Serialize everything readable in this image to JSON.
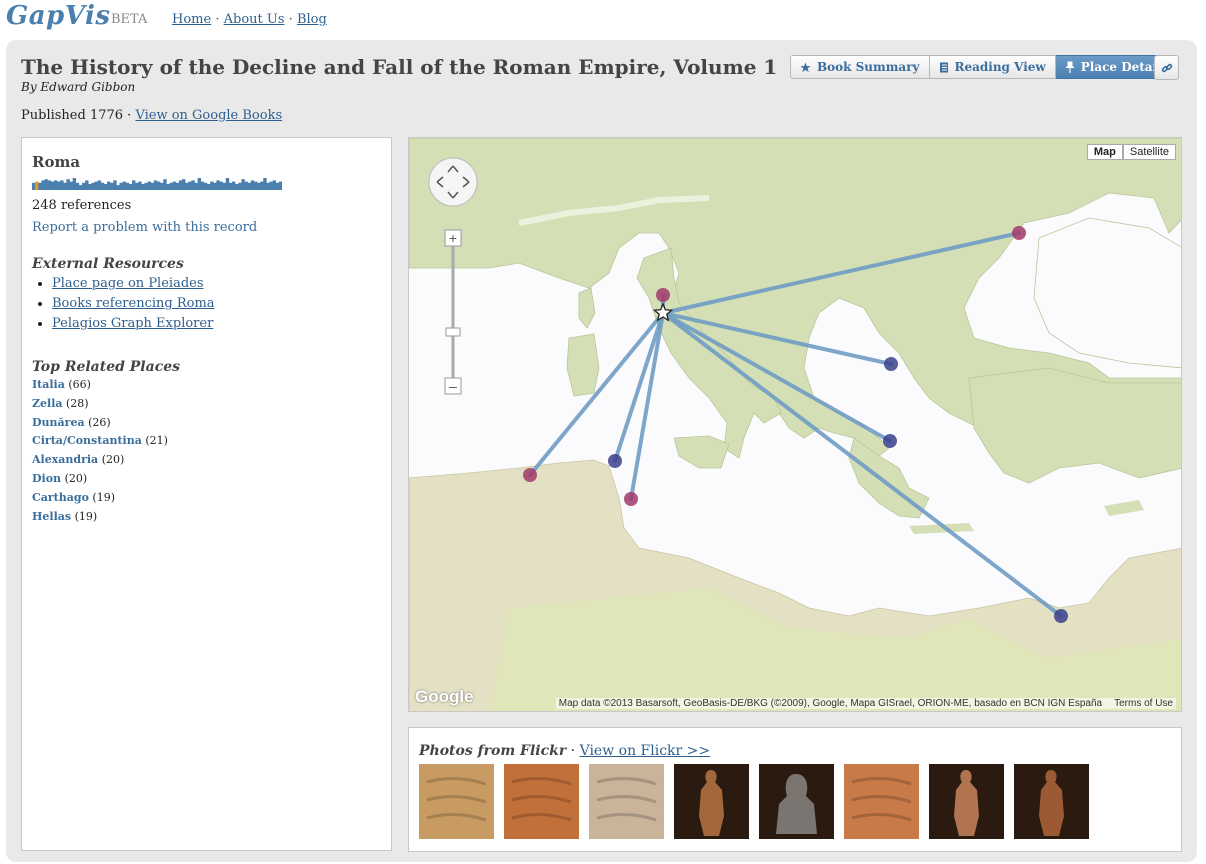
{
  "header": {
    "logo": "GapVis",
    "beta": "BETA",
    "nav": [
      {
        "label": "Home"
      },
      {
        "label": "About Us"
      },
      {
        "label": "Blog"
      }
    ],
    "sep": "·"
  },
  "book": {
    "title": "The History of the Decline and Fall of the Roman Empire, Volume 1",
    "author": "By Edward Gibbon",
    "published": "Published 1776 ·",
    "google_link": "View on Google Books"
  },
  "views": {
    "summary": "Book Summary",
    "reading": "Reading View",
    "place": "Place Detail",
    "active": "place"
  },
  "place": {
    "name": "Roma",
    "references": "248 references",
    "report": "Report a problem with this record",
    "reference_bars": [
      0.6,
      0.7,
      0.6,
      0.8,
      0.9,
      0.8,
      0.7,
      0.8,
      0.7,
      0.8,
      0.6,
      0.9,
      0.7,
      1.0,
      0.6,
      0.4,
      0.6,
      0.8,
      0.5,
      0.6,
      0.7,
      0.8,
      0.6,
      0.5,
      0.7,
      0.6,
      0.8,
      0.4,
      0.6,
      0.7,
      0.6,
      0.5,
      0.8,
      0.6,
      0.7,
      0.5,
      0.6,
      0.7,
      0.6,
      0.8,
      0.7,
      0.6,
      0.9,
      0.5,
      0.6,
      0.7,
      0.6,
      0.8,
      0.9,
      0.6,
      0.7,
      0.8,
      0.6,
      1.0,
      0.7,
      0.6,
      0.5,
      0.7,
      0.6,
      0.8,
      0.7,
      0.6,
      1.0,
      0.6,
      0.7,
      0.5,
      0.6,
      0.9,
      0.7,
      0.6,
      0.8,
      0.7,
      0.6,
      0.7,
      1.0,
      0.6,
      0.7,
      0.8,
      0.6,
      0.7
    ],
    "current_bar": 1
  },
  "external": {
    "heading": "External Resources",
    "links": [
      {
        "label": "Place page on Pleiades"
      },
      {
        "label": "Books referencing Roma"
      },
      {
        "label": "Pelagios Graph Explorer"
      }
    ]
  },
  "related": {
    "heading": "Top Related Places",
    "items": [
      {
        "name": "Italia",
        "count": "(66)"
      },
      {
        "name": "Zella",
        "count": "(28)"
      },
      {
        "name": "Dunărea",
        "count": "(26)"
      },
      {
        "name": "Cirta/Constantina",
        "count": "(21)"
      },
      {
        "name": "Alexandria",
        "count": "(20)"
      },
      {
        "name": "Dion",
        "count": "(20)"
      },
      {
        "name": "Carthago",
        "count": "(19)"
      },
      {
        "name": "Hellas",
        "count": "(19)"
      }
    ]
  },
  "map": {
    "type_map": "Map",
    "type_satellite": "Satellite",
    "attribution": "Map data ©2013 Basarsoft, GeoBasis-DE/BKG (©2009), Google, Mapa GISrael, ORION-ME, basado en BCN IGN España",
    "terms": "Terms of Use",
    "google_logo": "Google",
    "colors": {
      "sea": "#fbfbfd",
      "land": "#d4dfb6",
      "line": "#6f9cc4",
      "red": "#a13a6a",
      "blue": "#3a3f8c"
    }
  },
  "photos": {
    "heading": "Photos from Flickr",
    "sep": " · ",
    "link": "View on Flickr >>",
    "items": [
      {
        "label": "relief",
        "tone": "#c89b62"
      },
      {
        "label": "relief",
        "tone": "#c2703a"
      },
      {
        "label": "inscription",
        "tone": "#c9b49a"
      },
      {
        "label": "statue",
        "tone": "#a2683c"
      },
      {
        "label": "bust",
        "tone": "#7a7570"
      },
      {
        "label": "inscription",
        "tone": "#c87a48"
      },
      {
        "label": "statue",
        "tone": "#b07450"
      },
      {
        "label": "statue",
        "tone": "#9c5a34"
      }
    ]
  }
}
